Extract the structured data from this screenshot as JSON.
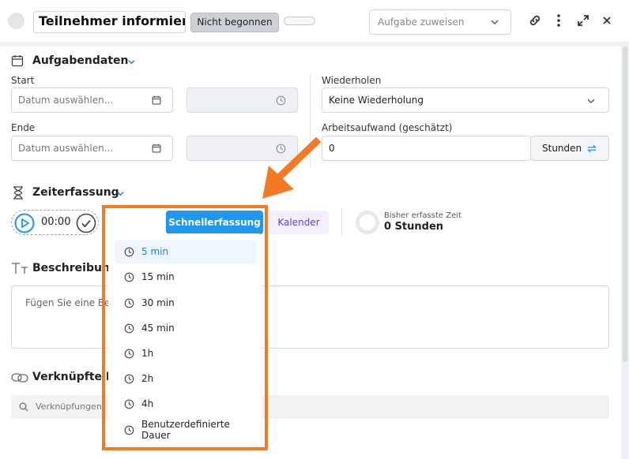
{
  "header": {
    "title": "Teilnehmer informieren",
    "status": "Nicht begonnen",
    "assign_placeholder": "Aufgabe zuweisen"
  },
  "task_data": {
    "section_title": "Aufgabendaten",
    "start_label": "Start",
    "end_label": "Ende",
    "date_placeholder": "Datum auswählen...",
    "repeat_label": "Wiederholen",
    "repeat_value": "Keine Wiederholung",
    "effort_label": "Arbeitsaufwand (geschätzt)",
    "effort_value": "0",
    "effort_unit": "Stunden"
  },
  "time_tracking": {
    "section_title": "Zeiterfassung",
    "timer": "00:00",
    "quick_tab": "Schnellerfassung",
    "calendar_tab": "Kalender",
    "tracked_label": "Bisher erfasste Zeit",
    "tracked_value": "0 Stunden"
  },
  "description": {
    "section_title": "Beschreibun",
    "placeholder": "Fügen Sie eine Be"
  },
  "linked": {
    "section_title": "Verknüpfte E",
    "search_placeholder": "Verknüpfungen"
  },
  "quick_menu": {
    "items": [
      {
        "label": "5 min"
      },
      {
        "label": "15 min"
      },
      {
        "label": "30 min"
      },
      {
        "label": "45 min"
      },
      {
        "label": "1h"
      },
      {
        "label": "2h"
      },
      {
        "label": "4h"
      },
      {
        "label": "Benutzerdefinierte Dauer"
      }
    ]
  },
  "colors": {
    "primary": "#1f96f0",
    "highlight": "#f27a24",
    "calendar_text": "#6a3fc9"
  }
}
